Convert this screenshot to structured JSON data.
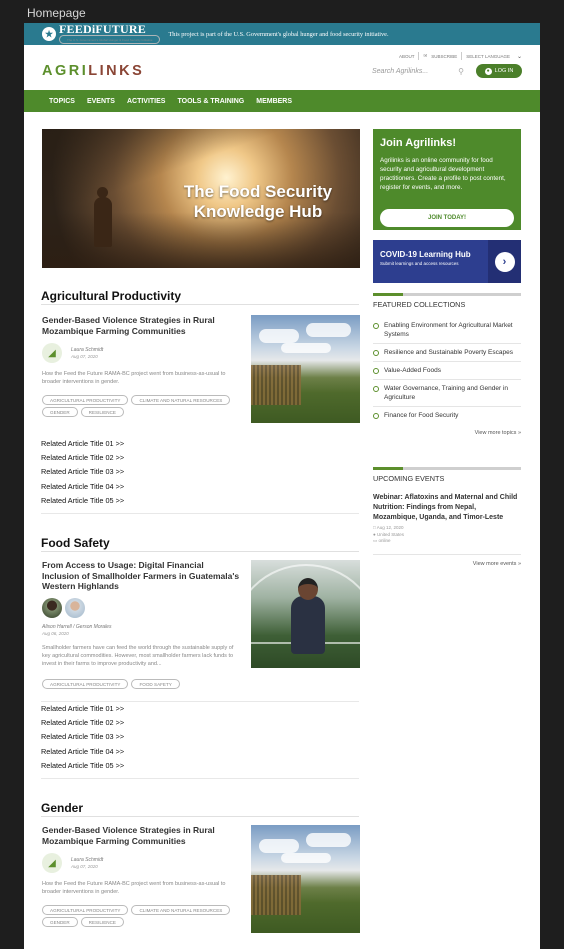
{
  "frame_title": "Homepage",
  "ftf": {
    "logo": "FEED",
    "logo_i": "i",
    "logo_rest": "FUTURE",
    "tagline": "The U.S. Government's Global Hunger & Food Security Initiative",
    "text": "This project is part of the U.S. Government's global hunger and food security initiative."
  },
  "header": {
    "brand_agri": "AGRI",
    "brand_links": "LINKS",
    "util": {
      "about": "ABOUT",
      "subscribe": "SUBSCRIBE",
      "language": "SELECT LANGUAGE"
    },
    "search_placeholder": "Search Agrilinks...",
    "login": "LOG IN"
  },
  "nav": [
    "TOPICS",
    "EVENTS",
    "ACTIVITIES",
    "TOOLS & TRAINING",
    "MEMBERS"
  ],
  "hero": {
    "title": "The Food Security Knowledge Hub"
  },
  "join": {
    "title": "Join Agrilinks!",
    "text": "Agrilinks is an online community for food security and agricultural development practitioners. Create a profile to post content, register for events, and more.",
    "button": "JOIN TODAY!"
  },
  "covid": {
    "title": "COVID-19 Learning Hub",
    "subtitle": "Submit learnings and access resources"
  },
  "featured": {
    "heading": "FEATURED COLLECTIONS",
    "items": [
      "Enabling Environment for Agricultural Market Systems",
      "Resilience and Sustainable Poverty Escapes",
      "Value-Added Foods",
      "Water Governance, Training and Gender in Agriculture",
      "Finance for Food Security"
    ],
    "view_more": "View more topics"
  },
  "events": {
    "heading": "UPCOMING EVENTS",
    "title": "Webinar: Aflatoxins and Maternal and Child Nutrition: Findings from Nepal, Mozambique, Uganda, and Timor-Leste",
    "date": "Aug 12, 2020",
    "location": "United States",
    "mode": "online",
    "view_more": "View more events"
  },
  "sections": [
    {
      "title": "Agricultural Productivity",
      "card": {
        "title": "Gender-Based Violence Strategies in Rural Mozambique Farming Communities",
        "author": "Laura Schmidt",
        "date": "Aug 07, 2020",
        "summary": "How the Feed the Future RAMA-BC project went from business-as-usual to broader interventions in gender.",
        "tags": [
          "AGRICULTURAL PRODUCTIVITY",
          "CLIMATE AND NATURAL RESOURCES",
          "GENDER",
          "RESILIENCE"
        ]
      },
      "related": [
        "Related Article Title 01 >>",
        "Related Article Title 02 >>",
        "Related Article Title 03 >>",
        "Related Article Title 04 >>",
        "Related Article Title 05 >>"
      ]
    },
    {
      "title": "Food Safety",
      "card": {
        "title": "From Access to Usage: Digital Financial Inclusion of Smallholder Farmers in Guatemala's Western Highlands",
        "author": "Alison Harrell / Gerson Morales",
        "date": "Aug 06, 2020",
        "summary": "Smallholder farmers have can feed the world through the sustainable supply of key agricultural commodities. However, most smallholder farmers lack funds to invest in their farms to improve productivity and...",
        "tags": [
          "AGRICULTURAL PRODUCTIVITY",
          "FOOD SAFETY"
        ]
      },
      "related": [
        "Related Article Title 01 >>",
        "Related Article Title 02 >>",
        "Related Article Title 03 >>",
        "Related Article Title 04 >>",
        "Related Article Title 05 >>"
      ]
    },
    {
      "title": "Gender",
      "card": {
        "title": "Gender-Based Violence Strategies in Rural Mozambique Farming Communities",
        "author": "Laura Schmidt",
        "date": "Aug 07, 2020",
        "summary": "How the Feed the Future RAMA-BC project went from business-as-usual to broader interventions in gender.",
        "tags": [
          "AGRICULTURAL PRODUCTIVITY",
          "CLIMATE AND NATURAL RESOURCES",
          "GENDER",
          "RESILIENCE"
        ]
      }
    }
  ]
}
